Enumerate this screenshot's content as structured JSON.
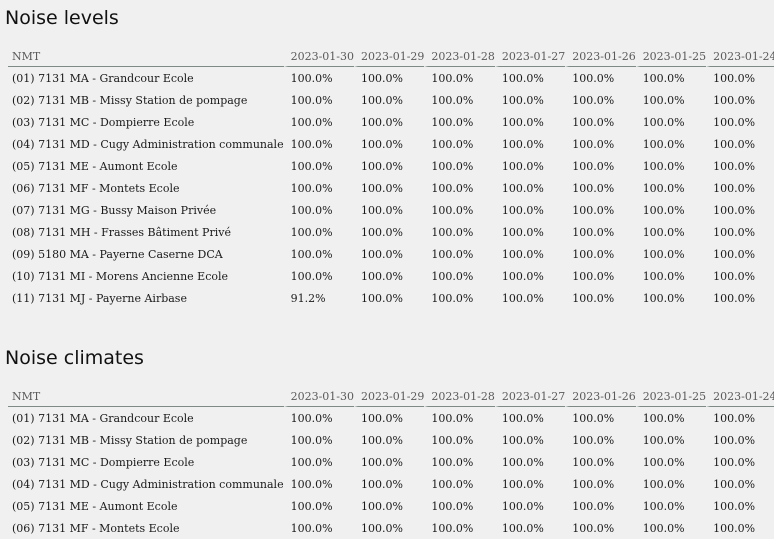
{
  "sections": [
    {
      "title": "Noise levels",
      "columns": [
        "NMT",
        "2023-01-30",
        "2023-01-29",
        "2023-01-28",
        "2023-01-27",
        "2023-01-26",
        "2023-01-25",
        "2023-01-24"
      ],
      "rows": [
        [
          "(01) 7131 MA - Grandcour Ecole",
          "100.0%",
          "100.0%",
          "100.0%",
          "100.0%",
          "100.0%",
          "100.0%",
          "100.0%"
        ],
        [
          "(02) 7131 MB - Missy Station de pompage",
          "100.0%",
          "100.0%",
          "100.0%",
          "100.0%",
          "100.0%",
          "100.0%",
          "100.0%"
        ],
        [
          "(03) 7131 MC - Dompierre Ecole",
          "100.0%",
          "100.0%",
          "100.0%",
          "100.0%",
          "100.0%",
          "100.0%",
          "100.0%"
        ],
        [
          "(04) 7131 MD - Cugy Administration communale",
          "100.0%",
          "100.0%",
          "100.0%",
          "100.0%",
          "100.0%",
          "100.0%",
          "100.0%"
        ],
        [
          "(05) 7131 ME - Aumont Ecole",
          "100.0%",
          "100.0%",
          "100.0%",
          "100.0%",
          "100.0%",
          "100.0%",
          "100.0%"
        ],
        [
          "(06) 7131 MF - Montets Ecole",
          "100.0%",
          "100.0%",
          "100.0%",
          "100.0%",
          "100.0%",
          "100.0%",
          "100.0%"
        ],
        [
          "(07) 7131 MG - Bussy Maison Privée",
          "100.0%",
          "100.0%",
          "100.0%",
          "100.0%",
          "100.0%",
          "100.0%",
          "100.0%"
        ],
        [
          "(08) 7131 MH - Frasses Bâtiment Privé",
          "100.0%",
          "100.0%",
          "100.0%",
          "100.0%",
          "100.0%",
          "100.0%",
          "100.0%"
        ],
        [
          "(09) 5180 MA - Payerne Caserne DCA",
          "100.0%",
          "100.0%",
          "100.0%",
          "100.0%",
          "100.0%",
          "100.0%",
          "100.0%"
        ],
        [
          "(10) 7131 MI - Morens Ancienne Ecole",
          "100.0%",
          "100.0%",
          "100.0%",
          "100.0%",
          "100.0%",
          "100.0%",
          "100.0%"
        ],
        [
          "(11) 7131 MJ - Payerne Airbase",
          "91.2%",
          "100.0%",
          "100.0%",
          "100.0%",
          "100.0%",
          "100.0%",
          "100.0%"
        ]
      ]
    },
    {
      "title": "Noise climates",
      "columns": [
        "NMT",
        "2023-01-30",
        "2023-01-29",
        "2023-01-28",
        "2023-01-27",
        "2023-01-26",
        "2023-01-25",
        "2023-01-24"
      ],
      "rows": [
        [
          "(01) 7131 MA - Grandcour Ecole",
          "100.0%",
          "100.0%",
          "100.0%",
          "100.0%",
          "100.0%",
          "100.0%",
          "100.0%"
        ],
        [
          "(02) 7131 MB - Missy Station de pompage",
          "100.0%",
          "100.0%",
          "100.0%",
          "100.0%",
          "100.0%",
          "100.0%",
          "100.0%"
        ],
        [
          "(03) 7131 MC - Dompierre Ecole",
          "100.0%",
          "100.0%",
          "100.0%",
          "100.0%",
          "100.0%",
          "100.0%",
          "100.0%"
        ],
        [
          "(04) 7131 MD - Cugy Administration communale",
          "100.0%",
          "100.0%",
          "100.0%",
          "100.0%",
          "100.0%",
          "100.0%",
          "100.0%"
        ],
        [
          "(05) 7131 ME - Aumont Ecole",
          "100.0%",
          "100.0%",
          "100.0%",
          "100.0%",
          "100.0%",
          "100.0%",
          "100.0%"
        ],
        [
          "(06) 7131 MF - Montets Ecole",
          "100.0%",
          "100.0%",
          "100.0%",
          "100.0%",
          "100.0%",
          "100.0%",
          "100.0%"
        ]
      ]
    }
  ]
}
